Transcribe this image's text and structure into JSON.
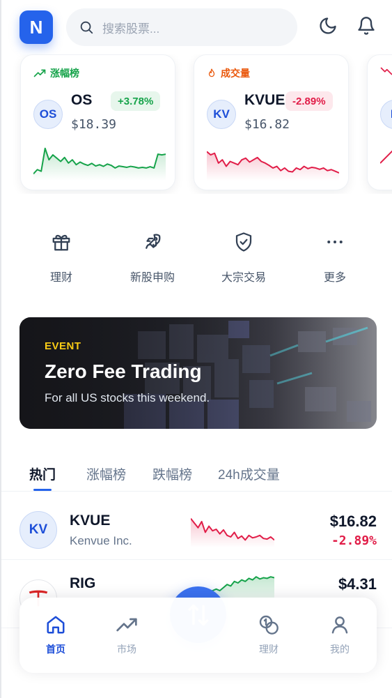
{
  "header": {
    "logo_letter": "N",
    "search_placeholder": "搜索股票...",
    "icons": [
      "search-icon",
      "moon-icon",
      "bell-icon"
    ]
  },
  "cards": [
    {
      "tag": "涨幅榜",
      "tag_icon": "trending-up-icon",
      "tag_color": "#16a34a",
      "avatar": "OS",
      "symbol": "OS",
      "price": "$18.39",
      "change": "+3.78%",
      "direction": "up",
      "trend": [
        0.12,
        0.25,
        0.2,
        0.9,
        0.55,
        0.7,
        0.6,
        0.5,
        0.62,
        0.45,
        0.55,
        0.4,
        0.48,
        0.42,
        0.38,
        0.44,
        0.36,
        0.4,
        0.35,
        0.42,
        0.38,
        0.3,
        0.36,
        0.34,
        0.32,
        0.35,
        0.33,
        0.3,
        0.32,
        0.3,
        0.34,
        0.3,
        0.72,
        0.7,
        0.72
      ]
    },
    {
      "tag": "成交量",
      "tag_icon": "fire-icon",
      "tag_color": "#ea580c",
      "avatar": "KV",
      "symbol": "KVUE",
      "price": "$16.82",
      "change": "-2.89%",
      "direction": "down",
      "trend": [
        0.8,
        0.7,
        0.75,
        0.45,
        0.55,
        0.35,
        0.5,
        0.45,
        0.4,
        0.55,
        0.6,
        0.48,
        0.55,
        0.62,
        0.5,
        0.45,
        0.38,
        0.3,
        0.35,
        0.22,
        0.3,
        0.2,
        0.18,
        0.3,
        0.25,
        0.35,
        0.28,
        0.32,
        0.3,
        0.26,
        0.3,
        0.22,
        0.25,
        0.2,
        0.15
      ]
    },
    {
      "tag": "",
      "avatar": "N",
      "direction": "down"
    }
  ],
  "actions": [
    {
      "icon": "gift-icon",
      "label": "理财"
    },
    {
      "icon": "rocket-icon",
      "label": "新股申购"
    },
    {
      "icon": "shield-check-icon",
      "label": "大宗交易"
    },
    {
      "icon": "more-dots-icon",
      "label": "更多"
    }
  ],
  "banner": {
    "event": "EVENT",
    "title": "Zero Fee Trading",
    "subtitle": "For all US stocks this weekend."
  },
  "tabs": [
    "热门",
    "涨幅榜",
    "跌幅榜",
    "24h成交量"
  ],
  "active_tab": 0,
  "list": [
    {
      "avatar": "KV",
      "symbol": "KVUE",
      "name": "Kenvue Inc.",
      "price": "$16.82",
      "change": "-2.89%",
      "direction": "down",
      "trend": [
        0.85,
        0.7,
        0.55,
        0.75,
        0.4,
        0.6,
        0.45,
        0.5,
        0.35,
        0.48,
        0.3,
        0.25,
        0.4,
        0.2,
        0.28,
        0.15,
        0.3,
        0.22,
        0.25,
        0.3,
        0.2,
        0.18,
        0.25,
        0.15
      ]
    },
    {
      "avatar": "T",
      "symbol": "RIG",
      "name": "",
      "price": "$4.31",
      "change": "",
      "direction": "up",
      "trend": [
        0.15,
        0.25,
        0.3,
        0.2,
        0.45,
        0.35,
        0.5,
        0.55,
        0.5,
        0.6,
        0.7,
        0.65,
        0.8,
        0.75,
        0.85,
        0.8,
        0.9,
        0.85,
        0.95,
        0.88,
        0.92,
        0.9,
        0.95,
        0.92
      ]
    }
  ],
  "nav": [
    {
      "icon": "home-icon",
      "label": "首页",
      "active": true
    },
    {
      "icon": "market-trend-icon",
      "label": "市场",
      "active": false
    },
    {
      "icon": "swap-icon",
      "label": "",
      "active": false
    },
    {
      "icon": "coins-icon",
      "label": "理财",
      "active": false
    },
    {
      "icon": "user-icon",
      "label": "我的",
      "active": false
    }
  ],
  "colors": {
    "accent": "#2563eb",
    "up": "#16a34a",
    "down": "#e11d48"
  }
}
